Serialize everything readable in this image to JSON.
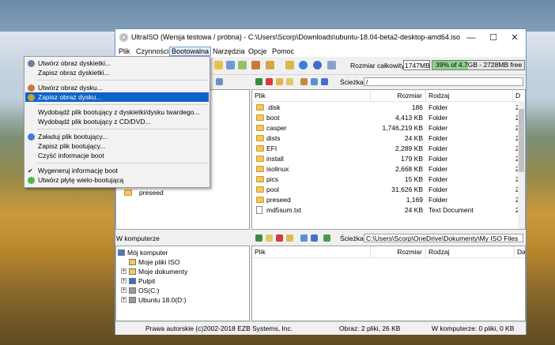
{
  "window": {
    "title": "UltraISO (Wersja testowa / próbna) - C:\\Users\\Scorp\\Downloads\\ubuntu-18.04-beta2-desktop-amd64.iso",
    "minimize": "—",
    "maximize": "☐",
    "close": "✕"
  },
  "menubar": {
    "items": [
      "Plik",
      "Czynności",
      "Bootowalna",
      "Narzędzia",
      "Opcje",
      "Pomoc"
    ],
    "active": "Bootowalna"
  },
  "toolbar": {
    "total_size_label": "Rozmiar całkowity:",
    "total_size_value": "1747MB",
    "capacity_text": "39% of 4.7GB - 2728MB free",
    "capacity_fraction": 0.39,
    "capacity_color": "#8fd18a"
  },
  "iso_panel": {
    "path_label": "Ścieżka:",
    "path_value": "/",
    "columns": [
      "Plik",
      "Rozmiar",
      "Rodzaj",
      "D"
    ],
    "tree_visible_item": "preseed",
    "files": [
      {
        "name": ".disk",
        "size": "186",
        "type": "Folder",
        "d": "2",
        "kind": "folder"
      },
      {
        "name": "boot",
        "size": "4,413 KB",
        "type": "Folder",
        "d": "2",
        "kind": "folder"
      },
      {
        "name": "casper",
        "size": "1,746,219 KB",
        "type": "Folder",
        "d": "2",
        "kind": "folder"
      },
      {
        "name": "dists",
        "size": "24 KB",
        "type": "Folder",
        "d": "2",
        "kind": "folder"
      },
      {
        "name": "EFI",
        "size": "2,289 KB",
        "type": "Folder",
        "d": "2",
        "kind": "folder"
      },
      {
        "name": "install",
        "size": "179 KB",
        "type": "Folder",
        "d": "2",
        "kind": "folder"
      },
      {
        "name": "isolinux",
        "size": "2,668 KB",
        "type": "Folder",
        "d": "2",
        "kind": "folder"
      },
      {
        "name": "pics",
        "size": "15 KB",
        "type": "Folder",
        "d": "2",
        "kind": "folder"
      },
      {
        "name": "pool",
        "size": "31,626 KB",
        "type": "Folder",
        "d": "2",
        "kind": "folder"
      },
      {
        "name": "preseed",
        "size": "1,169",
        "type": "Folder",
        "d": "2",
        "kind": "folder"
      },
      {
        "name": "md5sum.txt",
        "size": "24 KB",
        "type": "Text Document",
        "d": "2",
        "kind": "file"
      }
    ]
  },
  "local_panel": {
    "header": "W komputerze",
    "path_label": "Ścieżka:",
    "path_value": "C:\\Users\\Scorp\\OneDrive\\Dokumenty\\My ISO Files",
    "columns": [
      "Plik",
      "Rozmiar",
      "Rodzaj",
      "Data"
    ],
    "tree": [
      {
        "label": "Mój komputer",
        "indent": 0,
        "expand": false,
        "icon": "computer-icon"
      },
      {
        "label": "Moje pliki ISO",
        "indent": 1,
        "expand": false,
        "icon": "folder-icon"
      },
      {
        "label": "Moje dokumenty",
        "indent": 1,
        "expand": true,
        "icon": "folder-icon"
      },
      {
        "label": "Pulpit",
        "indent": 1,
        "expand": true,
        "icon": "desktop-icon"
      },
      {
        "label": "OS(C:)",
        "indent": 1,
        "expand": true,
        "icon": "drive-icon"
      },
      {
        "label": "Ubuntu 18.0(D:)",
        "indent": 1,
        "expand": true,
        "icon": "drive-icon"
      }
    ]
  },
  "dropdown": {
    "items": [
      {
        "label": "Utwórz obraz dyskietki...",
        "icon": "floppy-icon",
        "sep_after": false
      },
      {
        "label": "Zapisz obraz dyskietki...",
        "icon": "",
        "sep_after": true
      },
      {
        "label": "Utwórz obraz dysku...",
        "icon": "disk-icon",
        "sep_after": false
      },
      {
        "label": "Zapisz obraz dysku...",
        "icon": "disk-write-icon",
        "sep_after": true,
        "highlight": true
      },
      {
        "label": "Wydobądź plik bootujący z dyskietki/dysku twardego...",
        "icon": "",
        "sep_after": false
      },
      {
        "label": "Wydobądź plik bootujący z CD/DVD...",
        "icon": "",
        "sep_after": true
      },
      {
        "label": "Załaduj plik bootujący...",
        "icon": "gear-icon",
        "sep_after": false
      },
      {
        "label": "Zapisz plik bootujący...",
        "icon": "",
        "sep_after": false
      },
      {
        "label": "Czyść informacje boot",
        "icon": "",
        "sep_after": true
      },
      {
        "label": "Wygeneruj informację boot",
        "icon": "check-icon",
        "sep_after": false
      },
      {
        "label": "Utwórz płytę wielo-bootującą",
        "icon": "green-disk-icon",
        "sep_after": false
      }
    ]
  },
  "status": {
    "copyright": "Prawa autorskie (c)2002-2018 EZB Systems, Inc.",
    "image": "Obraz: 2 pliki, 26 KB",
    "local": "W komputerze: 0 pliki, 0 KB"
  }
}
